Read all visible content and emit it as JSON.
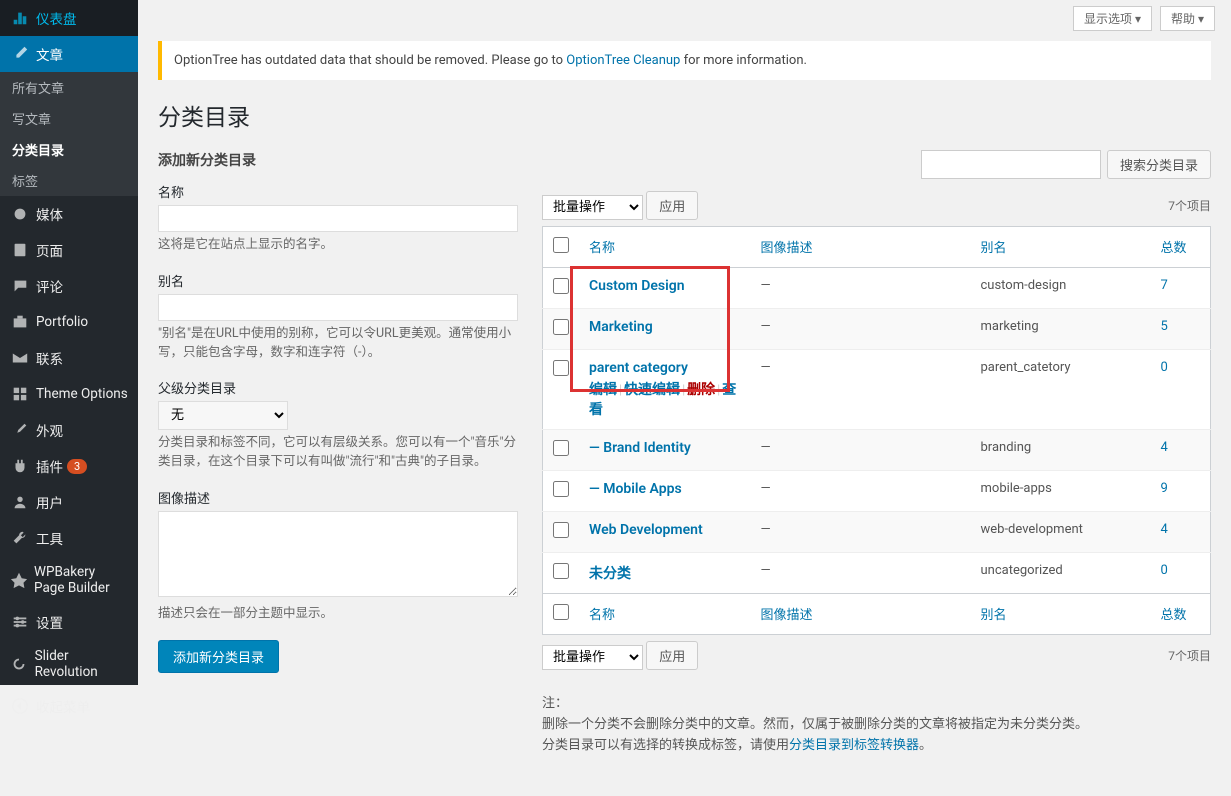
{
  "topbar": {
    "screen_options": "显示选项",
    "help": "帮助"
  },
  "sidebar": {
    "items": [
      {
        "label": "仪表盘",
        "icon": "dashboard"
      },
      {
        "label": "文章",
        "icon": "posts",
        "active": true
      },
      {
        "label": "媒体",
        "icon": "media"
      },
      {
        "label": "页面",
        "icon": "pages"
      },
      {
        "label": "评论",
        "icon": "comments"
      },
      {
        "label": "Portfolio",
        "icon": "portfolio"
      },
      {
        "label": "联系",
        "icon": "contact"
      },
      {
        "label": "Theme Options",
        "icon": "theme"
      },
      {
        "label": "外观",
        "icon": "appearance"
      },
      {
        "label": "插件",
        "icon": "plugins",
        "badge": "3"
      },
      {
        "label": "用户",
        "icon": "users"
      },
      {
        "label": "工具",
        "icon": "tools"
      },
      {
        "label": "WPBakery Page Builder",
        "icon": "wpbakery"
      },
      {
        "label": "设置",
        "icon": "settings"
      },
      {
        "label": "Slider Revolution",
        "icon": "slider"
      },
      {
        "label": "收起菜单",
        "icon": "collapse"
      }
    ],
    "sub": [
      "所有文章",
      "写文章",
      "分类目录",
      "标签"
    ],
    "sub_active": 2
  },
  "notice": {
    "prefix": "OptionTree has outdated data that should be removed. Please go to ",
    "link": "OptionTree Cleanup",
    "suffix": " for more information."
  },
  "page_title": "分类目录",
  "form": {
    "heading": "添加新分类目录",
    "name_label": "名称",
    "name_hint": "这将是它在站点上显示的名字。",
    "slug_label": "别名",
    "slug_hint": "\"别名\"是在URL中使用的别称，它可以令URL更美观。通常使用小写，只能包含字母，数字和连字符（-）。",
    "parent_label": "父级分类目录",
    "parent_select": "无",
    "parent_hint": "分类目录和标签不同，它可以有层级关系。您可以有一个\"音乐\"分类目录，在这个目录下可以有叫做\"流行\"和\"古典\"的子目录。",
    "image_label": "图像描述",
    "image_hint": "描述只会在一部分主题中显示。",
    "submit": "添加新分类目录"
  },
  "search": {
    "button": "搜索分类目录"
  },
  "bulk": {
    "label": "批量操作",
    "apply": "应用"
  },
  "count_text": "7个项目",
  "columns": {
    "name": "名称",
    "desc": "图像描述",
    "slug": "别名",
    "count": "总数"
  },
  "row_actions": {
    "edit": "编辑",
    "quick": "快速编辑",
    "delete": "删除",
    "view": "查看"
  },
  "rows": [
    {
      "name": "Custom Design",
      "desc": "—",
      "slug": "custom-design",
      "count": "7"
    },
    {
      "name": "Marketing",
      "desc": "—",
      "slug": "marketing",
      "count": "5"
    },
    {
      "name": "parent category",
      "desc": "—",
      "slug": "parent_catetory",
      "count": "0",
      "show_actions": true
    },
    {
      "name": "— Brand Identity",
      "desc": "—",
      "slug": "branding",
      "count": "4"
    },
    {
      "name": "— Mobile Apps",
      "desc": "—",
      "slug": "mobile-apps",
      "count": "9"
    },
    {
      "name": "Web Development",
      "desc": "—",
      "slug": "web-development",
      "count": "4"
    },
    {
      "name": "未分类",
      "desc": "—",
      "slug": "uncategorized",
      "count": "0"
    }
  ],
  "footnote": {
    "label": "注：",
    "l1": "删除一个分类不会删除分类中的文章。然而，仅属于被删除分类的文章将被指定为未分类分类。",
    "l2a": "分类目录可以有选择的转换成标签，请使用",
    "l2_link": "分类目录到标签转换器",
    "l2b": "。"
  }
}
